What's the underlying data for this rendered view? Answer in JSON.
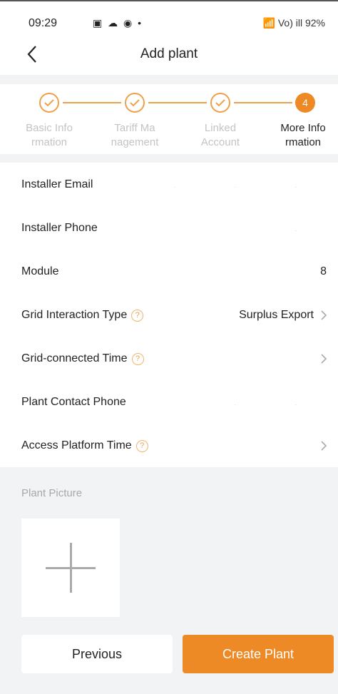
{
  "status_bar": {
    "time": "09:29",
    "icons": "▣ ☁ ◉ •",
    "right": "📶 Vo) ill 92%"
  },
  "nav": {
    "title": "Add plant"
  },
  "steps": [
    {
      "label_line1": "Basic Info",
      "label_line2": "rmation",
      "state": "done"
    },
    {
      "label_line1": "Tariff Ma",
      "label_line2": "nagement",
      "state": "done"
    },
    {
      "label_line1": "Linked",
      "label_line2": "Account",
      "state": "done"
    },
    {
      "label_line1": "More Info",
      "label_line2": "rmation",
      "state": "active",
      "number": "4"
    }
  ],
  "form": {
    "installer_email": {
      "label": "Installer Email"
    },
    "installer_phone": {
      "label": "Installer Phone"
    },
    "module": {
      "label": "Module",
      "value": "8"
    },
    "grid_interaction_type": {
      "label": "Grid Interaction Type",
      "value": "Surplus Export"
    },
    "grid_connected_time": {
      "label": "Grid-connected Time"
    },
    "plant_contact_phone": {
      "label": "Plant Contact Phone"
    },
    "access_platform_time": {
      "label": "Access Platform Time"
    }
  },
  "picture": {
    "label": "Plant Picture"
  },
  "buttons": {
    "previous": "Previous",
    "create": "Create Plant"
  },
  "colors": {
    "accent": "#ee8a25",
    "accent_light": "#f0a04a",
    "background": "#f2f3f5"
  }
}
